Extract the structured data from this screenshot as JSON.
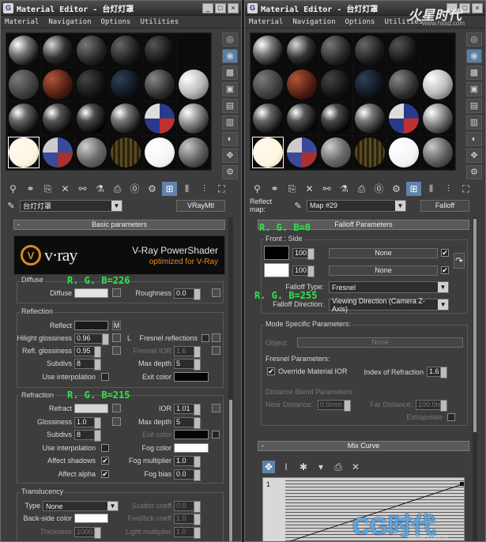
{
  "left": {
    "title": "Material Editor - 台灯灯罩",
    "menu": [
      "Material",
      "Navigation",
      "Options",
      "Utilities"
    ],
    "slot_spheres": [
      "radial-gradient(circle at 30% 30%, #ffffff, #777 35%, #111 75%)",
      "radial-gradient(circle at 30% 30%, #d8d8d8, #333 45%, #050505 80%)",
      "radial-gradient(circle at 30% 30%, #777, #222 60%, #000)",
      "radial-gradient(circle at 30% 30%, #666, #1a1a1a 60%, #000)",
      "radial-gradient(circle at 30% 30%, #555, #111 60%, #000)",
      "none",
      "radial-gradient(circle at 30% 30%, #7a7a7a, #3a3a3a 60%, #111)",
      "radial-gradient(circle at 30% 30%, #b0563a, #4a1a10 60%, #0d0503)",
      "radial-gradient(circle at 30% 30%, #444, #111 60%, #000)",
      "radial-gradient(circle at 30% 30%, #2f3f55, #0d131c 60%, #000)",
      "radial-gradient(circle at 30% 30%, #888, #2a2a2a 60%, #050505)",
      "radial-gradient(circle at 30% 30%, #ffffff, #bdbdbd 50%, #444)",
      "radial-gradient(circle at 30% 30%, #ffffff, #666 30%, #0a0a0a 75%)",
      "radial-gradient(circle at 30% 30%, #ffffff, #555 30%, #050505 75%)",
      "radial-gradient(circle at 30% 30%, #ffffff, #4a4a4a 30%, #000 75%)",
      "radial-gradient(circle at 30% 30%, #ffffff, #777 30%, #111 75%)",
      "conic-gradient(#2a3a8a 0 25%, #c03030 25% 50%, #2a3a8a 50% 75%, #ddd 75%)",
      "radial-gradient(circle at 30% 30%, #ffffff, #999 35%, #222 80%)",
      "radial-gradient(circle at 30% 30%, #fffaf0, #fff6e0 60%, #d8cfb5)",
      "conic-gradient(#3a4a9a 0 25%, #a83030 25% 50%, #3a4a9a 50% 75%, #ccc 75%)",
      "radial-gradient(circle at 30% 30%, #cfcfcf, #6a6a6a 50%, #333)",
      "repeating-linear-gradient(90deg, #5a4a20 0 3px, #2a2210 3px 6px)",
      "radial-gradient(circle at 30% 30%, #ffffff, #f4f4f4 60%, #cfcfcf)",
      "radial-gradient(circle at 30% 30%, #c8c8c8, #5a5a5a 55%, #1a1a1a)"
    ],
    "active_slot": 18,
    "side_tools": [
      "◎",
      "◉",
      "▩",
      "▣",
      "▤",
      "▥",
      "◐",
      "✥",
      "⚙"
    ],
    "toolbar": [
      "⚲",
      "⚭",
      "⎘",
      "✕",
      "⚯",
      "⚗",
      "⎙",
      "⓪",
      "⚙",
      "⊞",
      "⫴",
      "⫶",
      "⛶"
    ],
    "material_name": "台灯灯罩",
    "material_type": "VRayMtl",
    "rollout": "Basic parameters",
    "logo": {
      "mark": "V",
      "word": "v·ray",
      "line1": "V-Ray PowerShader",
      "line2": "optimized for V-Ray"
    },
    "diffuse": {
      "group": "Diffuse",
      "diffuse_label": "Diffuse",
      "diffuse_color": "#e2e2e2",
      "roughness_label": "Roughness",
      "roughness": "0.0",
      "note": "R. G. B=226"
    },
    "reflection": {
      "group": "Reflection",
      "reflect_label": "Reflect",
      "reflect_color": "#1a1a1a",
      "m": "M",
      "hilight_label": "Hilight glossiness",
      "hilight": "0.96",
      "l": "L",
      "fresnel_label": "Fresnel reflections",
      "refl_gloss_label": "Refl. glossiness",
      "refl_gloss": "0.95",
      "fresnel_ior_label": "Fresnel IOR",
      "fresnel_ior": "1.6",
      "subdivs_label": "Subdivs",
      "subdivs": "8",
      "max_depth_label": "Max depth",
      "max_depth": "5",
      "interp_label": "Use interpolation",
      "exit_label": "Exit color",
      "exit_color": "#050505"
    },
    "refraction": {
      "group": "Refraction",
      "note": "R. G. B=215",
      "refract_label": "Refract",
      "refract_color": "#d7d7d7",
      "ior_label": "IOR",
      "ior": "1.01",
      "gloss_label": "Glossiness",
      "gloss": "1.0",
      "max_depth_label": "Max depth",
      "max_depth": "5",
      "subdivs_label": "Subdivs",
      "subdivs": "8",
      "exit_label": "Exit color",
      "interp_label": "Use interpolation",
      "fog_color_label": "Fog color",
      "fog_color": "#ffffff",
      "shadows_label": "Affect shadows",
      "fog_mult_label": "Fog multiplier",
      "fog_mult": "1.0",
      "alpha_label": "Affect alpha",
      "fog_bias_label": "Fog bias",
      "fog_bias": "0.0"
    },
    "translucency": {
      "group": "Translucency",
      "type_label": "Type",
      "type_value": "None",
      "scatter_label": "Scatter coeff",
      "scatter": "0.0",
      "backside_label": "Back-side color",
      "fwd_label": "Fwd/bck coeff",
      "fwd": "1.0",
      "thickness_label": "Thickness",
      "thickness": "1000.0",
      "light_label": "Light multiplier",
      "light": "1.0"
    }
  },
  "right": {
    "title": "Material Editor - 台灯灯罩",
    "menu": [
      "Material",
      "Navigation",
      "Options",
      "Utilities"
    ],
    "watermark_top": "火星时代",
    "watermark_sub": "www.hxsd.com",
    "reflect_map_label": "Reflect map:",
    "map_name": "Map #29",
    "map_type": "Falloff",
    "rollout": "Falloff Parameters",
    "note_rgb0": "R. G. B=0",
    "front_side": "Front : Side",
    "color1": "#000000",
    "amount1": "100.0",
    "map1": "None",
    "color2": "#ffffff",
    "amount2": "100.0",
    "map2": "None",
    "note_rgb255": "R. G. B=255",
    "falloff_type_label": "Falloff Type:",
    "falloff_type": "Fresnel",
    "falloff_dir_label": "Falloff Direction:",
    "falloff_dir": "Viewing Direction (Camera Z-Axis)",
    "mode_title": "Mode Specific Parameters:",
    "object_label": "Object:",
    "object_value": "None",
    "fresnel_title": "Fresnel Parameters:",
    "override_label": "Override Material IOR",
    "ior_label": "Index of Refraction",
    "ior_value": "1.6",
    "dist_title": "Distance Blend Parameters:",
    "near_label": "Near Distance:",
    "near_value": "0.0mm",
    "far_label": "Far Distance:",
    "far_value": "100.0mm",
    "extrapolate_label": "Extrapolate",
    "mix_rollout": "Mix Curve",
    "curve_tools": [
      "✥",
      "I",
      "✱",
      "▾",
      "⎙",
      "✕"
    ],
    "curve_point": "1",
    "watermark_bottom": "CG时代",
    "watermark_url": "cgtime.com.cn"
  }
}
